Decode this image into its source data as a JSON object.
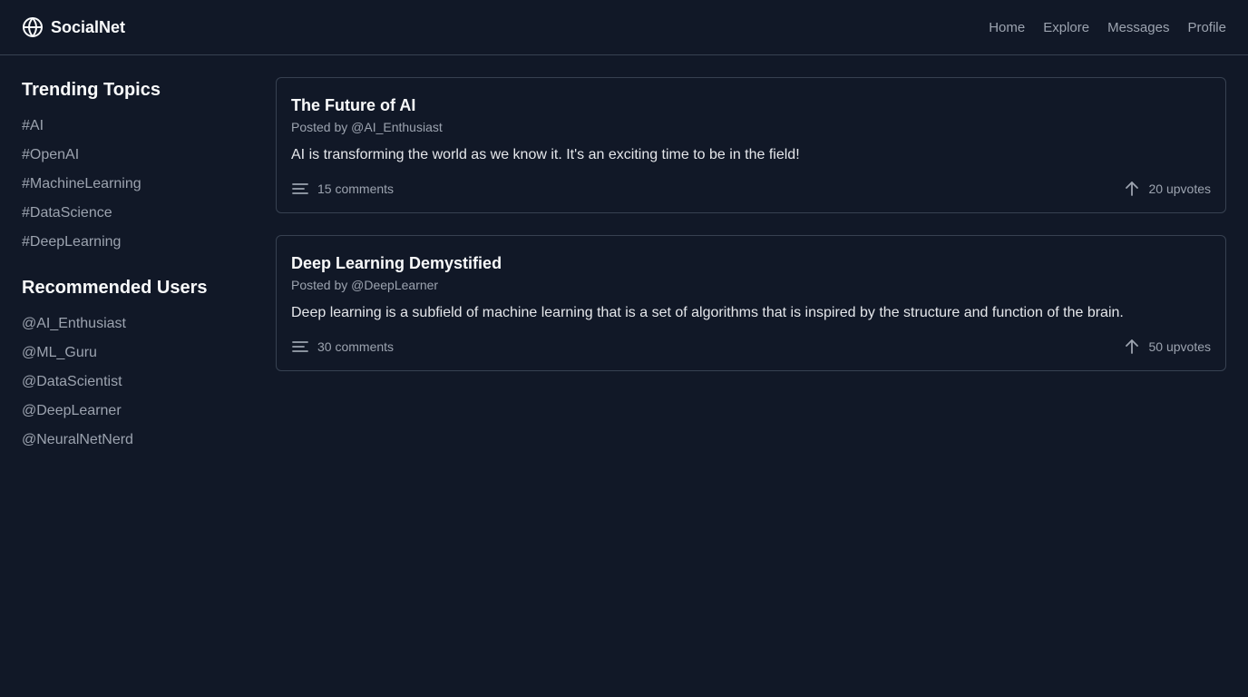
{
  "header": {
    "brand": "SocialNet",
    "brand_icon": "globe-icon",
    "nav": [
      {
        "label": "Home"
      },
      {
        "label": "Explore"
      },
      {
        "label": "Messages"
      },
      {
        "label": "Profile"
      }
    ]
  },
  "sidebar": {
    "trending_heading": "Trending Topics",
    "topics": [
      "#AI",
      "#OpenAI",
      "#MachineLearning",
      "#DataScience",
      "#DeepLearning"
    ],
    "users_heading": "Recommended Users",
    "users": [
      "@AI_Enthusiast",
      "@ML_Guru",
      "@DataScientist",
      "@DeepLearner",
      "@NeuralNetNerd"
    ]
  },
  "posts": [
    {
      "title": "The Future of AI",
      "author": "Posted by @AI_Enthusiast",
      "body": "AI is transforming the world as we know it. It's an exciting time to be in the field!",
      "comments": "15 comments",
      "upvotes": "20 upvotes"
    },
    {
      "title": "Deep Learning Demystified",
      "author": "Posted by @DeepLearner",
      "body": "Deep learning is a subfield of machine learning that is a set of algorithms that is inspired by the structure and function of the brain.",
      "comments": "30 comments",
      "upvotes": "50 upvotes"
    }
  ],
  "colors": {
    "background": "#111827",
    "border": "#374151",
    "muted_text": "#9ca3af",
    "primary_text": "#f9fafb"
  }
}
